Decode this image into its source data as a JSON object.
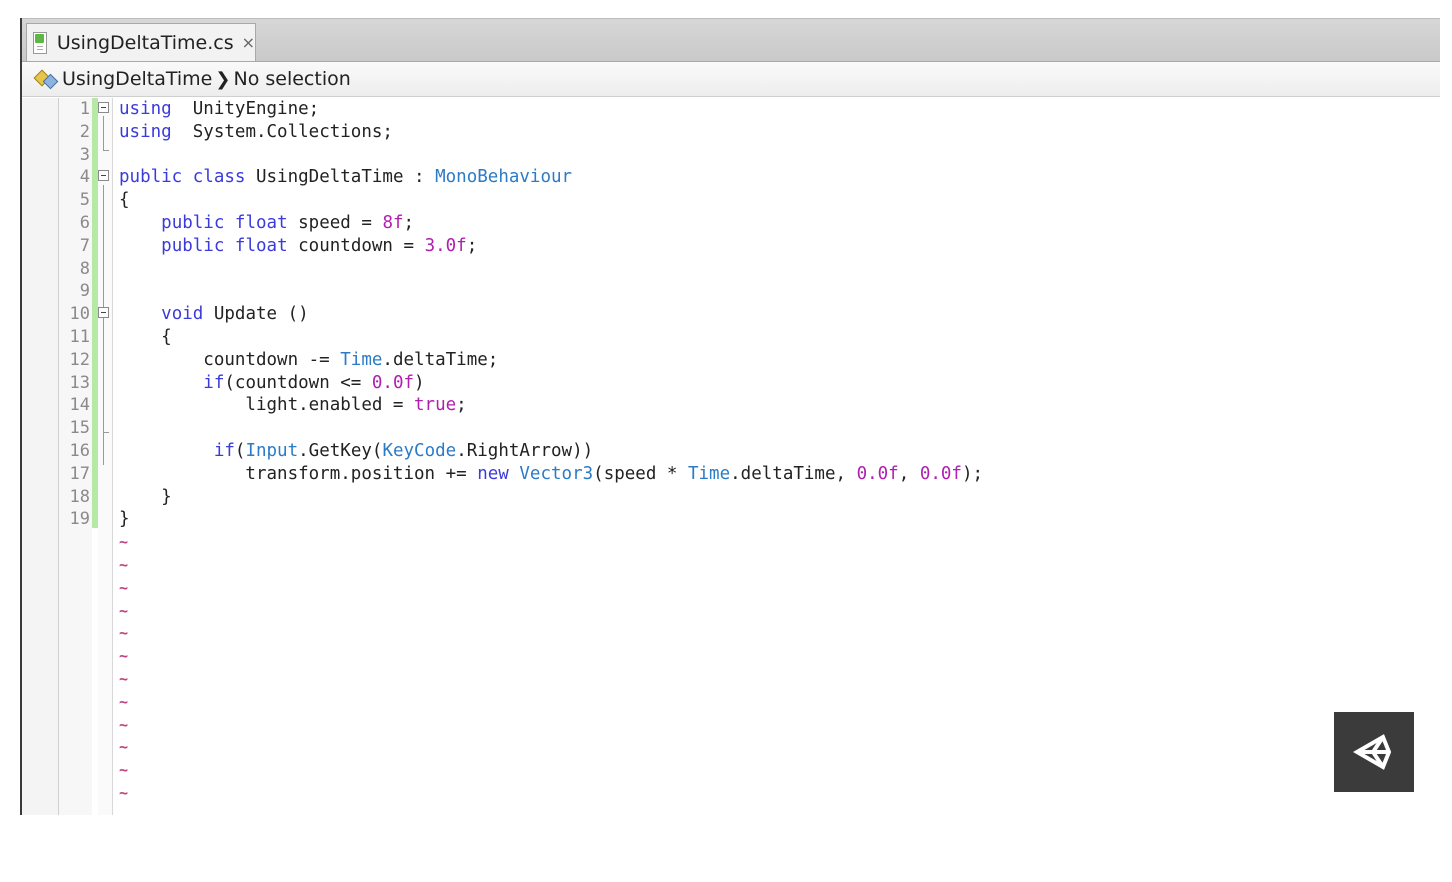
{
  "tab": {
    "filename": "UsingDeltaTime.cs",
    "close_glyph": "×",
    "icon": "csharp-file-icon"
  },
  "breadcrumb": {
    "class_name": "UsingDeltaTime",
    "separator": "❯",
    "selection": "No selection",
    "icon": "class-members-icon"
  },
  "editor": {
    "lines": [
      {
        "n": "1",
        "code": [
          [
            "kw",
            "using"
          ],
          [
            "",
            "  UnityEngine;"
          ]
        ]
      },
      {
        "n": "2",
        "code": [
          [
            "kw",
            "using"
          ],
          [
            "",
            "  System.Collections;"
          ]
        ]
      },
      {
        "n": "3",
        "code": []
      },
      {
        "n": "4",
        "code": [
          [
            "kw",
            "public"
          ],
          [
            "",
            " "
          ],
          [
            "kw",
            "class"
          ],
          [
            "",
            " UsingDeltaTime : "
          ],
          [
            "ty",
            "MonoBehaviour"
          ]
        ]
      },
      {
        "n": "5",
        "code": [
          [
            "",
            "{"
          ]
        ]
      },
      {
        "n": "6",
        "code": [
          [
            "",
            "    "
          ],
          [
            "kw",
            "public"
          ],
          [
            "",
            " "
          ],
          [
            "kw",
            "float"
          ],
          [
            "",
            " speed = "
          ],
          [
            "num",
            "8f"
          ],
          [
            "",
            ";"
          ]
        ]
      },
      {
        "n": "7",
        "code": [
          [
            "",
            "    "
          ],
          [
            "kw",
            "public"
          ],
          [
            "",
            " "
          ],
          [
            "kw",
            "float"
          ],
          [
            "",
            " countdown = "
          ],
          [
            "num",
            "3.0f"
          ],
          [
            "",
            ";"
          ]
        ]
      },
      {
        "n": "8",
        "code": []
      },
      {
        "n": "9",
        "code": []
      },
      {
        "n": "10",
        "code": [
          [
            "",
            "    "
          ],
          [
            "kw",
            "void"
          ],
          [
            "",
            " Update ()"
          ]
        ]
      },
      {
        "n": "11",
        "code": [
          [
            "",
            "    {"
          ]
        ]
      },
      {
        "n": "12",
        "code": [
          [
            "",
            "        countdown -= "
          ],
          [
            "ty",
            "Time"
          ],
          [
            "",
            ".deltaTime;"
          ]
        ]
      },
      {
        "n": "13",
        "code": [
          [
            "",
            "        "
          ],
          [
            "kw",
            "if"
          ],
          [
            "",
            "(countdown <= "
          ],
          [
            "num",
            "0.0f"
          ],
          [
            "",
            ")"
          ]
        ]
      },
      {
        "n": "14",
        "code": [
          [
            "",
            "            light.enabled = "
          ],
          [
            "num",
            "true"
          ],
          [
            "",
            ";"
          ]
        ]
      },
      {
        "n": "15",
        "code": []
      },
      {
        "n": "16",
        "code": [
          [
            "",
            "         "
          ],
          [
            "kw",
            "if"
          ],
          [
            "",
            "("
          ],
          [
            "ty",
            "Input"
          ],
          [
            "",
            ".GetKey("
          ],
          [
            "ty",
            "KeyCode"
          ],
          [
            "",
            ".RightArrow))"
          ]
        ]
      },
      {
        "n": "17",
        "code": [
          [
            "",
            "            transform.position += "
          ],
          [
            "kw",
            "new"
          ],
          [
            "",
            " "
          ],
          [
            "ty",
            "Vector3"
          ],
          [
            "",
            "(speed * "
          ],
          [
            "ty",
            "Time"
          ],
          [
            "",
            ".deltaTime, "
          ],
          [
            "num",
            "0.0f"
          ],
          [
            "",
            ", "
          ],
          [
            "num",
            "0.0f"
          ],
          [
            "",
            ");"
          ]
        ]
      },
      {
        "n": "18",
        "code": [
          [
            "",
            "    }"
          ]
        ]
      },
      {
        "n": "19",
        "code": [
          [
            "",
            "}"
          ]
        ]
      }
    ],
    "tilde": "~",
    "tilde_count": 13
  },
  "badge": {
    "icon": "unity-logo-icon",
    "color": "#3b3b3b"
  },
  "colors": {
    "keyword": "#3b3bdb",
    "type": "#2b7bc7",
    "number": "#b020b0",
    "tilde": "#c0407a"
  }
}
